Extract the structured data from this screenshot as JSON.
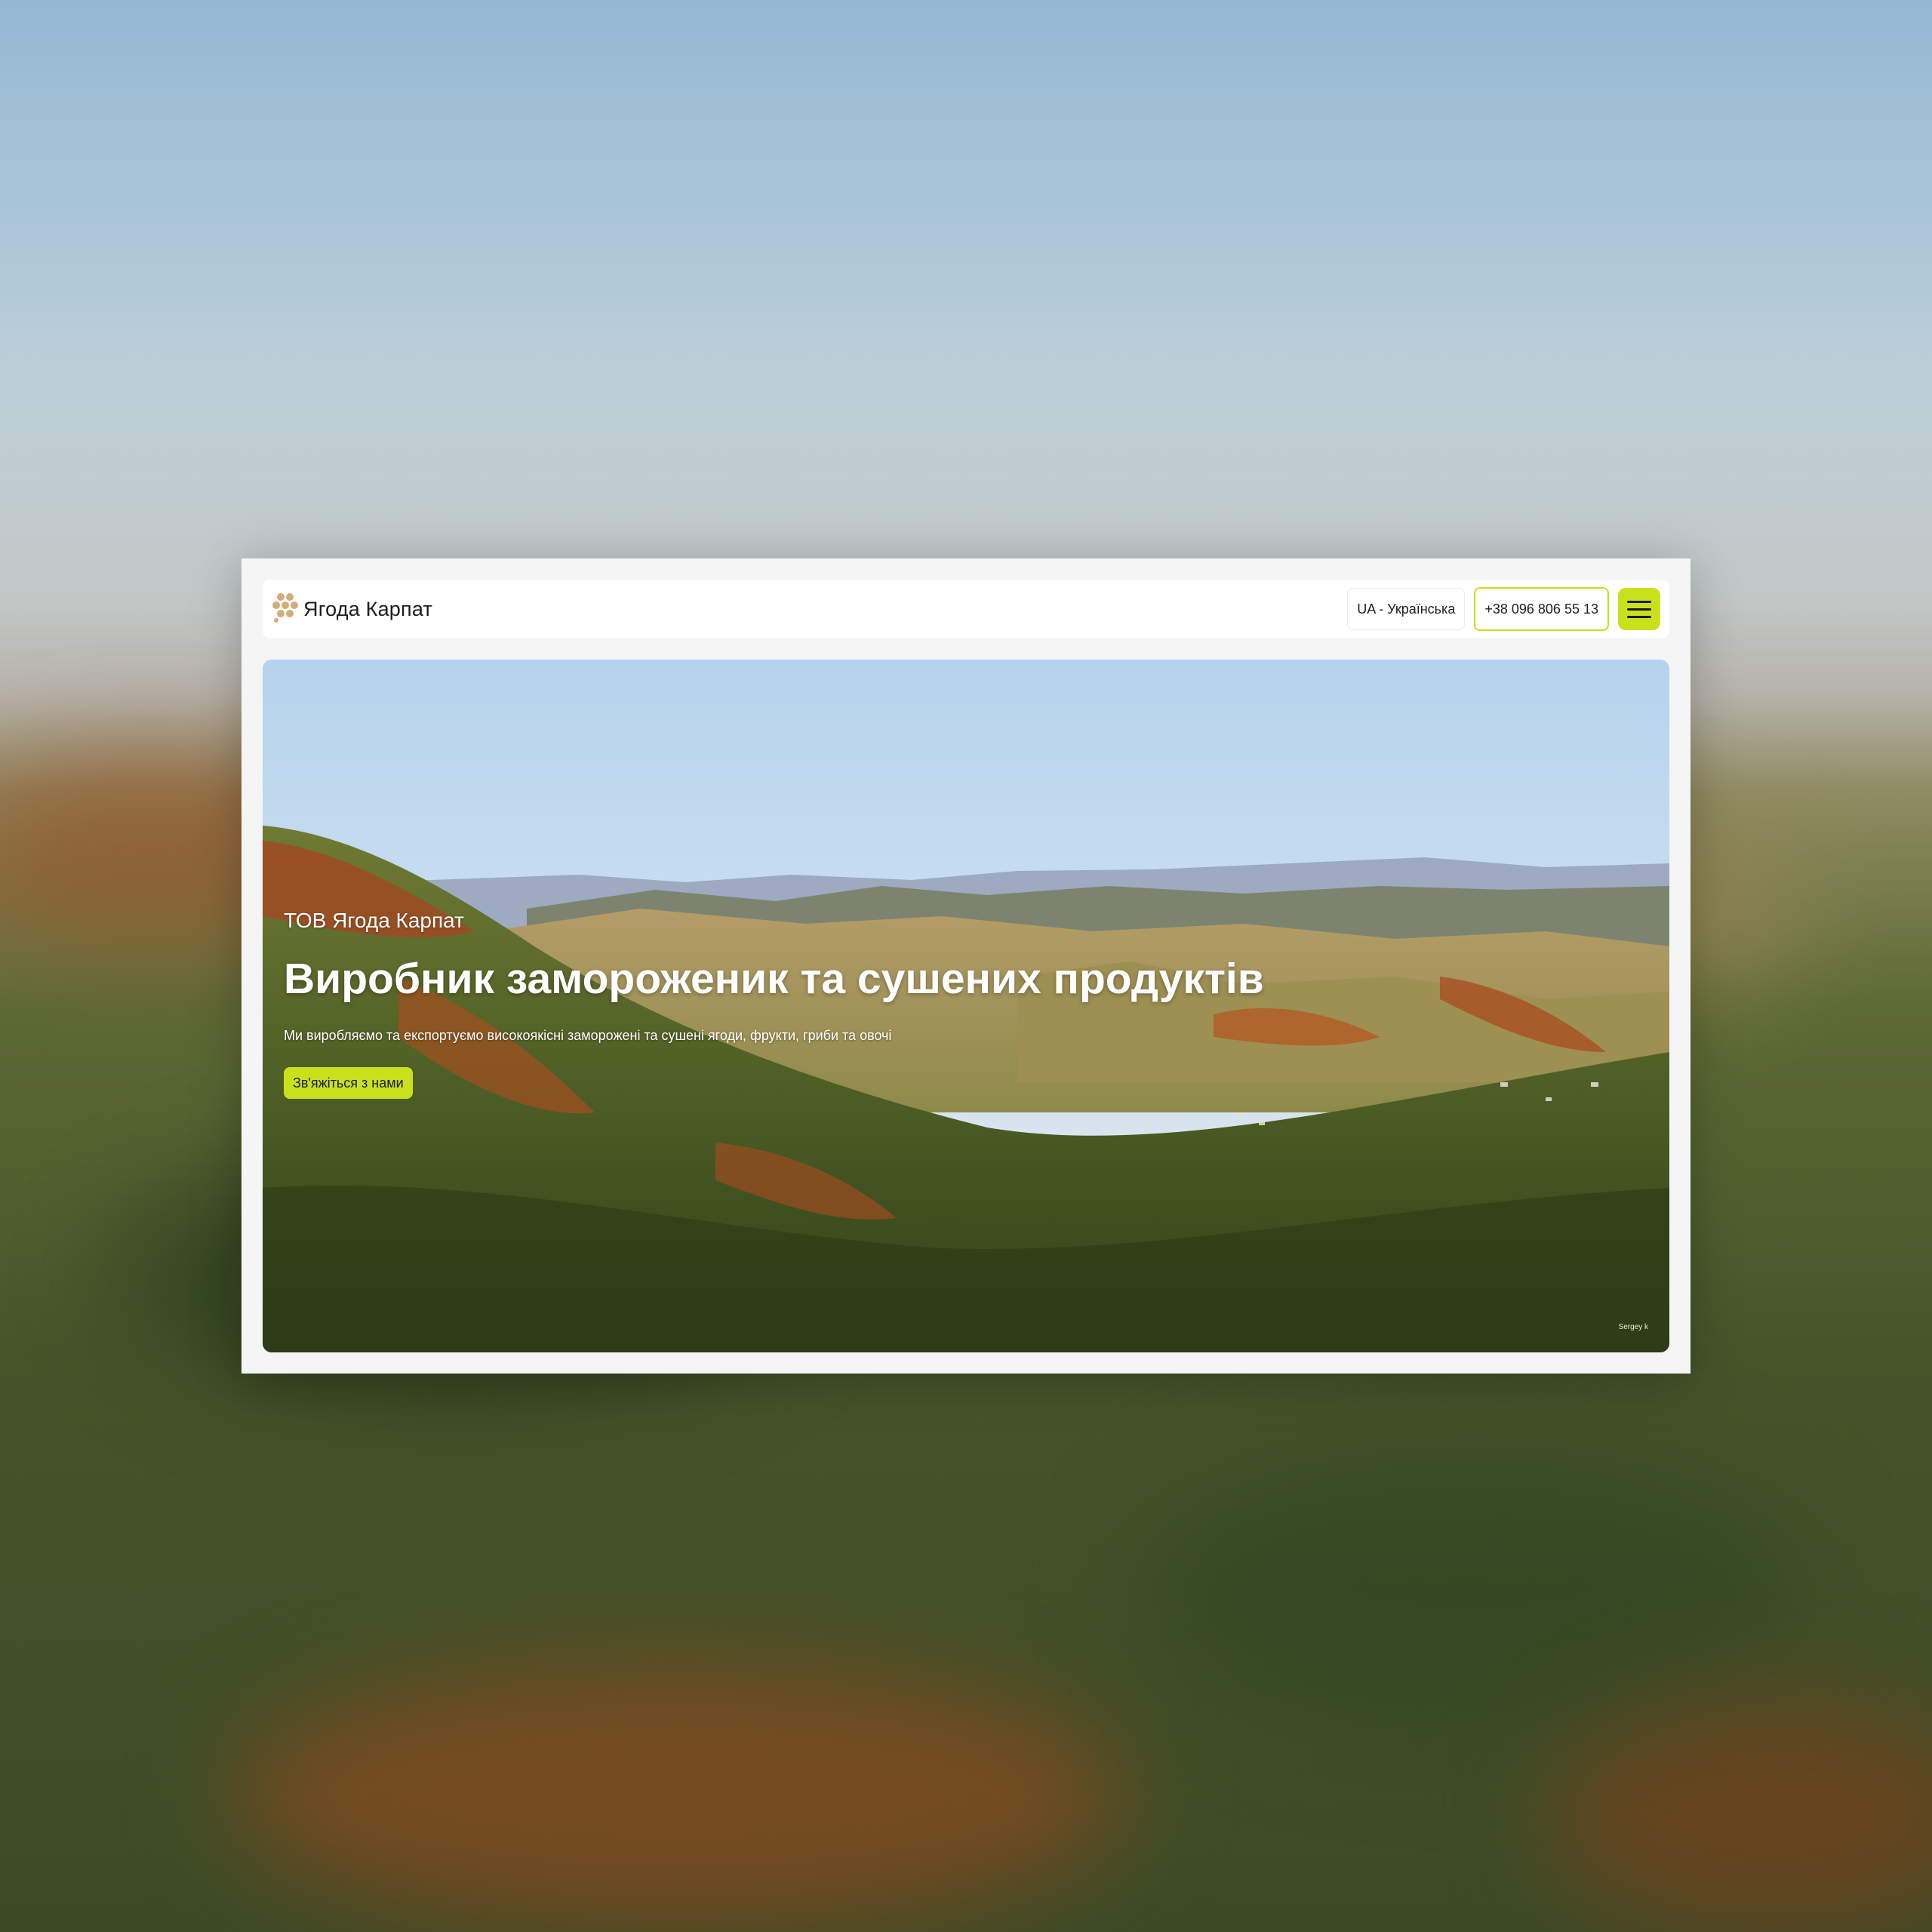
{
  "header": {
    "logo_text": "Ягода Карпат",
    "language_label": "UA - Українська",
    "phone_label": "+38 096 806 55 13"
  },
  "hero": {
    "eyebrow": "ТОВ Ягода Карпат",
    "title": "Виробник замороженик та сушених продуктів",
    "subtitle": "Ми виробляємо та експортуємо високоякісні заморожені та сушені ягоди, фрукти, гриби та овочі",
    "cta_label": "Зв'яжіться з нами",
    "photo_credit": "Sergey k"
  },
  "icons": {
    "logo": "berry-cluster-icon",
    "menu": "hamburger-menu-icon"
  },
  "colors": {
    "accent": "#c9e01c",
    "accent_border": "#c8df16",
    "logo": "#d4ac78",
    "card_bg": "#f5f5f5",
    "header_bg": "#ffffff",
    "text_dark": "#1d1d1d"
  }
}
